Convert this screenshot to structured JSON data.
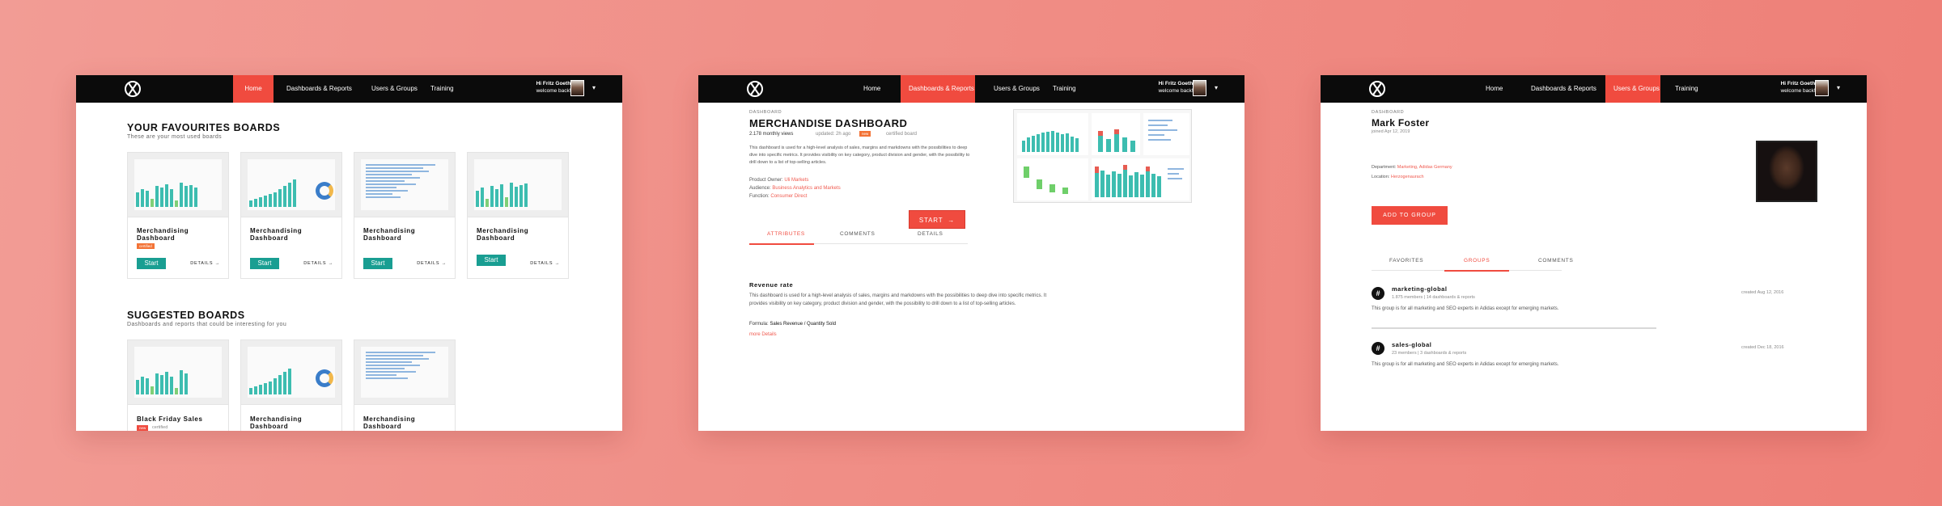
{
  "nav": {
    "items": [
      "Home",
      "Dashboards & Reports",
      "Users & Groups",
      "Training"
    ],
    "greeting_line1": "Hi Fritz Goeth,",
    "greeting_line2": "welcome back!",
    "caret": "▾"
  },
  "screen1": {
    "active_nav": "Home",
    "favourites_title": "YOUR FAVOURITES BOARDS",
    "favourites_subtitle": "These are your most used boards",
    "favourites": [
      {
        "title": "Merchandising Dashboard",
        "badge": "certified",
        "start": "Start",
        "details": "DETAILS"
      },
      {
        "title": "Merchandising Dashboard",
        "start": "Start",
        "details": "DETAILS"
      },
      {
        "title": "Merchandising Dashboard",
        "start": "Start",
        "details": "DETAILS"
      },
      {
        "title": "Merchandising Dashboard",
        "start": "Start",
        "details": "DETAILS"
      }
    ],
    "suggested_title": "SUGGESTED BOARDS",
    "suggested_subtitle": "Dashboards and reports that could be interesting for you",
    "suggested": [
      {
        "title": "Black Friday Sales",
        "badge": "new",
        "tag": "certified"
      },
      {
        "title": "Merchandising Dashboard"
      },
      {
        "title": "Merchandising Dashboard"
      }
    ]
  },
  "screen2": {
    "active_nav": "Dashboards & Reports",
    "label": "DASHBOARD",
    "title": "MERCHANDISE DASHBOARD",
    "views": "2.178 monthly views",
    "updated": "updated: 2h ago",
    "new_badge": "new",
    "certified": "certified board",
    "description": "This dashboard is used for a high-level analysis of sales, margins and markdowns with the possibilities to deep dive into specific metrics. It provides visibility on key category, product division and gender, with the possibility to drill down to a list of top-selling articles.",
    "owner_label": "Product Owner:",
    "owner_value": "Uli Markets",
    "audience_label": "Audience:",
    "audience_value": "Business Analytics and Markets",
    "function_label": "Function:",
    "function_value": "Consumer Direct",
    "start": "START",
    "tabs": [
      "ATTRIBUTES",
      "COMMENTS",
      "DETAILS"
    ],
    "section_title": "Revenue rate",
    "section_text": "This dashboard is used for a high-level analysis of sales, margins and markdowns with the possibilities to deep dive into specific metrics. It provides visibility on key category, product division and gender, with the possibility to drill down to a list of top-selling articles.",
    "formula_label": "Formula:",
    "formula_value": "Sales Revenue / Quantity Sold",
    "more": "more Details"
  },
  "screen3": {
    "active_nav": "Users & Groups",
    "label": "DASHBOARD",
    "name": "Mark Foster",
    "joined": "joined Apr 12, 2019",
    "department_label": "Department:",
    "department_value": "Marketing, Adidas Germany",
    "location_label": "Location:",
    "location_value": "Herzogenaurach",
    "add_button": "ADD TO GROUP",
    "tabs": [
      "FAVORITES",
      "GROUPS",
      "COMMENTS"
    ],
    "groups": [
      {
        "name": "marketing-global",
        "meta": "1.875 members | 14 dashboards & reports",
        "desc": "This group is for all marketing and SEO experts in Adidas except for emerging markets.",
        "date": "created Aug 12, 2016"
      },
      {
        "name": "sales-global",
        "meta": "23 members | 3 dashboards & reports",
        "desc": "This group is for all marketing and SEO experts in Adidas except for emerging markets.",
        "date": "created Dec 18, 2016"
      }
    ]
  },
  "colors": {
    "accent": "#f04b3f",
    "teal": "#199e92",
    "navbar": "#0b0b0b",
    "badge": "#f37336"
  }
}
